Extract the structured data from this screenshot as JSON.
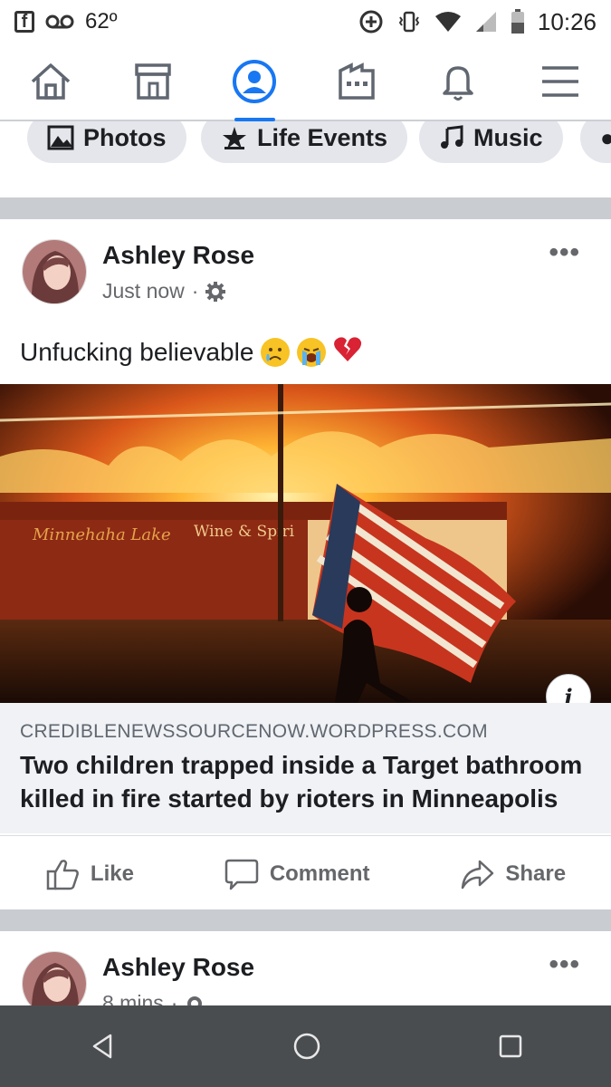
{
  "statusbar": {
    "temperature": "62º",
    "time": "10:26"
  },
  "nav": {
    "items": [
      "home-icon",
      "marketplace-icon",
      "profile-icon",
      "pages-icon",
      "notifications-icon",
      "menu-icon"
    ],
    "active": "profile-icon",
    "accent": "#1877f2"
  },
  "chips": [
    {
      "label": "Photos",
      "icon": "photo-icon"
    },
    {
      "label": "Life Events",
      "icon": "star-icon"
    },
    {
      "label": "Music",
      "icon": "music-note-icon"
    }
  ],
  "post1": {
    "author": "Ashley Rose",
    "time": "Just now",
    "message": "Unfucking believable",
    "emojis": [
      "sad-tear-emoji",
      "crying-emoji",
      "broken-heart-emoji"
    ],
    "link": {
      "domain": "CREDIBLENEWSSOURCENOW.WORDPRESS.COM",
      "headline": "Two children trapped inside a Target bathroom killed in fire started by rioters in Minneapolis"
    },
    "photo_signage": {
      "store_name": "Minnehaha Lake",
      "store_type": "Wine & Spiri"
    }
  },
  "actions": {
    "like": "Like",
    "comment": "Comment",
    "share": "Share"
  },
  "post2": {
    "author": "Ashley Rose",
    "time": "8 mins"
  },
  "colors": {
    "separator": "#c9ccd1",
    "chip_bg": "#e4e6eb",
    "secondary_text": "#65676b",
    "link_bg": "#f0f2f5"
  }
}
